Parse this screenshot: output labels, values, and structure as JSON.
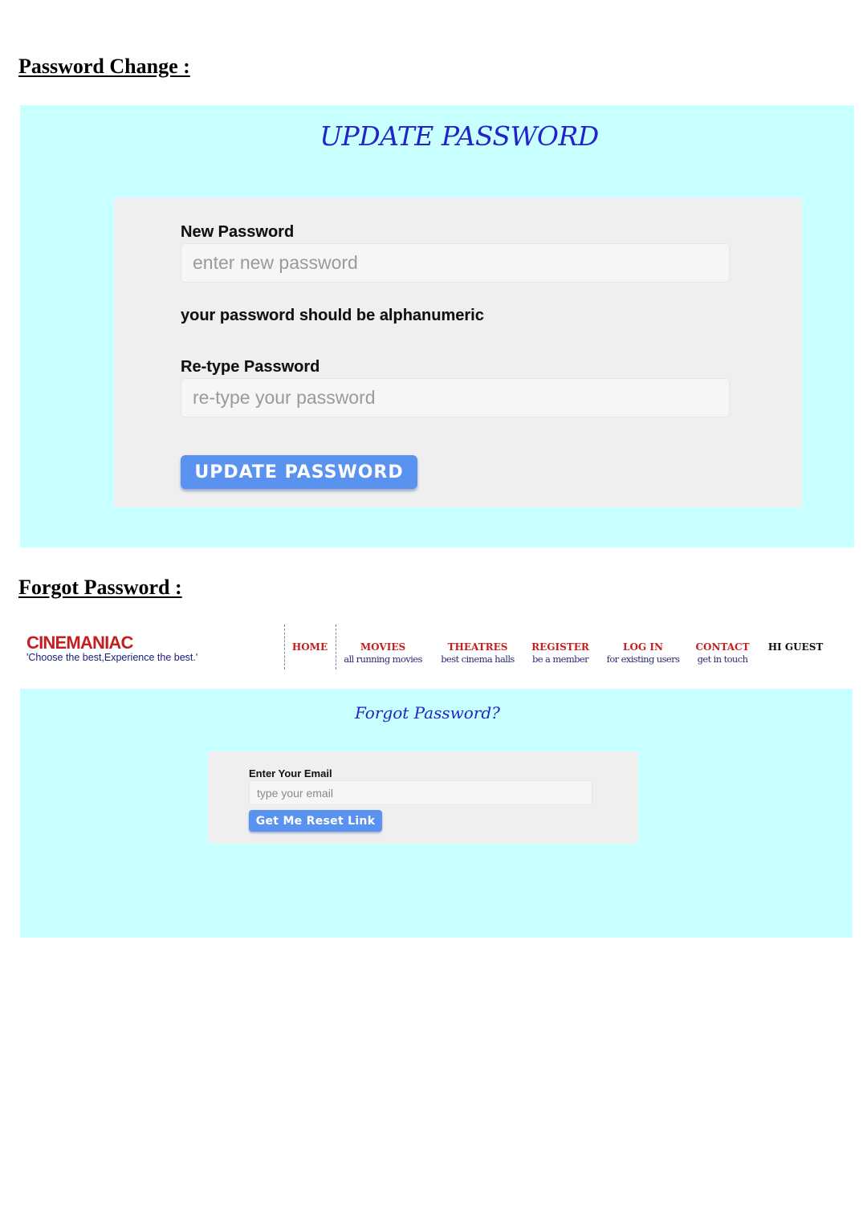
{
  "sections": {
    "password_change_heading": "Password Change :",
    "forgot_password_heading": "Forgot Password :"
  },
  "update_form": {
    "title": "UPDATE PASSWORD",
    "new_password_label": "New Password",
    "new_password_placeholder": "enter new password",
    "hint": "your password should be alphanumeric",
    "retype_label": "Re-type Password",
    "retype_placeholder": "re-type your password",
    "submit_label": "UPDATE PASSWORD"
  },
  "site_header": {
    "logo": "CINEMANIAC",
    "tagline": "'Choose the best,Experience the best.'",
    "nav": [
      {
        "title": "HOME",
        "subtitle": ""
      },
      {
        "title": "MOVIES",
        "subtitle": "all running movies"
      },
      {
        "title": "THEATRES",
        "subtitle": "best cinema halls"
      },
      {
        "title": "REGISTER",
        "subtitle": "be a member"
      },
      {
        "title": "LOG IN",
        "subtitle": "for existing users"
      },
      {
        "title": "CONTACT",
        "subtitle": "get in touch"
      }
    ],
    "greeting": "HI GUEST"
  },
  "forgot_form": {
    "title": "Forgot Password?",
    "email_label": "Enter Your Email",
    "email_placeholder": "type your email",
    "submit_label": "Get Me Reset Link"
  },
  "colors": {
    "panel_bg": "#c8ffff",
    "card_bg": "#efefef",
    "title_blue": "#2323c8",
    "button_blue": "#5a92f0",
    "nav_red": "#c41e1e"
  }
}
